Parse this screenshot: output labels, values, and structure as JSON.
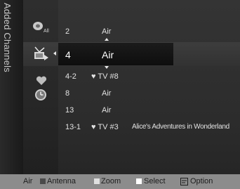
{
  "sidebar": {
    "title": "Added Channels"
  },
  "icon_column": {
    "icons": [
      "all-channels-icon",
      "antenna-icon",
      "favorite-heart-icon",
      "timer-clock-icon"
    ],
    "icon_label_all": "All"
  },
  "channels": [
    {
      "number": "2",
      "name": "Air",
      "program": ""
    },
    {
      "number": "4",
      "name": "Air",
      "program": "",
      "selected": true
    },
    {
      "number": "4-2",
      "name": "♥ TV #8",
      "program": ""
    },
    {
      "number": "8",
      "name": "Air",
      "program": ""
    },
    {
      "number": "13",
      "name": "Air",
      "program": ""
    },
    {
      "number": "13-1",
      "name": "♥ TV #3",
      "program": "Alice's Adventures in Wonderland"
    }
  ],
  "bottom_bar": {
    "source": "Air",
    "buttons": [
      {
        "label": "Antenna",
        "color": "#4a4a4a"
      },
      {
        "label": "Zoom",
        "color": "#e0e0e0"
      },
      {
        "label": "Select",
        "color": "#ffffff"
      },
      {
        "label": "Option",
        "icon": "option-icon"
      }
    ]
  },
  "colors": {
    "background": "#2c2c2c",
    "selected_row": "#111111",
    "bottom_bar": "#8c8c8c"
  }
}
